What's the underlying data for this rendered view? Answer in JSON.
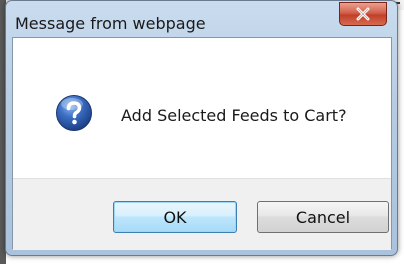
{
  "dialog": {
    "title": "Message from webpage",
    "message": "Add Selected Feeds to Cart?",
    "icon": "question-icon",
    "ok_label": "OK",
    "cancel_label": "Cancel",
    "close_icon": "close-icon"
  },
  "colors": {
    "close_button": "#c7462f",
    "frame": "#b9cfe6",
    "ok_border": "#3c7fb1",
    "icon_blue": "#2a5fb0"
  }
}
